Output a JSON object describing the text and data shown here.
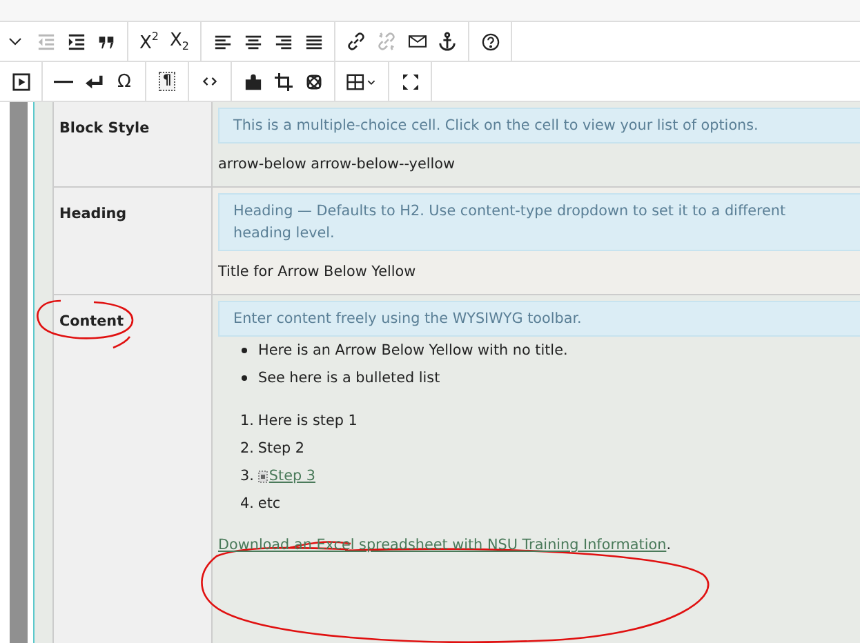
{
  "toolbar": {
    "rows": [
      {
        "groups": [
          {
            "buttons": [
              {
                "kind": "caret",
                "disabled": false
              },
              {
                "kind": "outdent",
                "disabled": true
              },
              {
                "kind": "indent",
                "disabled": false
              },
              {
                "kind": "blockquote",
                "disabled": false
              }
            ]
          },
          {
            "buttons": [
              {
                "kind": "glyph",
                "glyph": "X$^{2}$",
                "disabled": false
              },
              {
                "kind": "glyph",
                "glyph": "X$_{2}$",
                "disabled": false
              }
            ]
          },
          {
            "buttons": [
              {
                "kind": "align-left",
                "disabled": false
              },
              {
                "kind": "align-center",
                "disabled": false
              },
              {
                "kind": "align-right",
                "disabled": false
              },
              {
                "kind": "justify",
                "disabled": false
              }
            ]
          },
          {
            "buttons": [
              {
                "kind": "link",
                "disabled": false
              },
              {
                "kind": "unlink",
                "disabled": true
              },
              {
                "kind": "mail",
                "disabled": false
              },
              {
                "kind": "anchor",
                "disabled": false
              }
            ]
          },
          {
            "buttons": [
              {
                "kind": "help",
                "disabled": false
              }
            ]
          }
        ]
      },
      {
        "groups": [
          {
            "buttons": [
              {
                "kind": "media",
                "disabled": false
              }
            ]
          },
          {
            "buttons": [
              {
                "kind": "rule",
                "disabled": false
              },
              {
                "kind": "return",
                "disabled": false
              },
              {
                "kind": "glyph",
                "glyph": "Ω",
                "disabled": false
              }
            ]
          },
          {
            "buttons": [
              {
                "kind": "blocks",
                "glyph": "¶",
                "disabled": false
              }
            ]
          },
          {
            "buttons": [
              {
                "kind": "source",
                "disabled": false
              }
            ]
          },
          {
            "buttons": [
              {
                "kind": "puzzle",
                "disabled": false
              },
              {
                "kind": "crop",
                "disabled": false
              },
              {
                "kind": "atom",
                "disabled": false
              }
            ]
          },
          {
            "buttons": [
              {
                "kind": "table",
                "disabled": false
              }
            ]
          },
          {
            "buttons": [
              {
                "kind": "fullscreen",
                "disabled": false
              }
            ]
          }
        ]
      }
    ]
  },
  "fields": [
    {
      "label": "Block Style",
      "hint": "This is a multiple-choice cell. Click on the cell to view your list of options.",
      "kind": "text",
      "value": "arrow-below arrow-below--yellow"
    },
    {
      "label": "Heading",
      "hint": "Heading — Defaults to H2. Use content-type dropdown to set it to a different heading level.",
      "kind": "text",
      "value": "Title for Arrow Below Yellow"
    },
    {
      "label": "Content",
      "hint": "Enter content freely using the WYSIWYG toolbar.",
      "kind": "rich",
      "bullets": [
        "Here is an Arrow Below Yellow with no title.",
        "See here is a bulleted list"
      ],
      "steps": [
        {
          "num": "1.",
          "text": "Here is step 1",
          "link": false
        },
        {
          "num": "2.",
          "text": "Step 2",
          "link": false
        },
        {
          "num": "3.",
          "text": "Step 3",
          "link": true
        },
        {
          "num": "4.",
          "text": "etc",
          "link": false
        }
      ],
      "download_link": "Download an Excel spreadsheet with NSU Training Information",
      "after_link": "."
    }
  ]
}
